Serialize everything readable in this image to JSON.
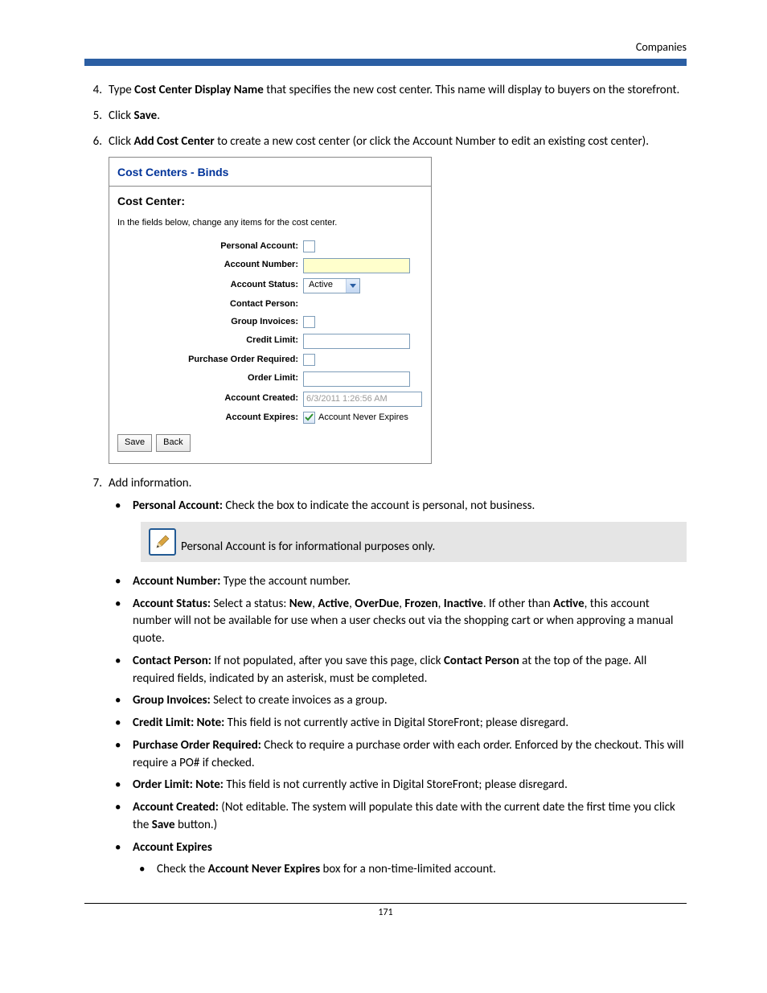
{
  "header": {
    "section": "Companies"
  },
  "steps": {
    "s4": {
      "pre": "Type ",
      "b": "Cost Center Display Name",
      "post": " that specifies the new cost center. This name will display to buyers on the storefront."
    },
    "s5": {
      "pre": "Click ",
      "b": "Save",
      "post": "."
    },
    "s6": {
      "pre": "Click ",
      "b": "Add Cost Center",
      "post": " to create a new cost center (or click the Account Number to edit an existing cost center)."
    },
    "s7": {
      "text": "Add information."
    }
  },
  "panel": {
    "title": "Cost Centers - Binds",
    "subtitle": "Cost Center:",
    "note": "In the fields below, change any items for the cost center.",
    "labels": {
      "personal": "Personal Account:",
      "acctnum": "Account Number:",
      "status": "Account Status:",
      "contact": "Contact Person:",
      "group": "Group Invoices:",
      "credit": "Credit Limit:",
      "po": "Purchase Order Required:",
      "order": "Order Limit:",
      "created": "Account Created:",
      "expires": "Account Expires:"
    },
    "values": {
      "status": "Active",
      "created": "6/3/2011 1:26:56 AM",
      "expires_label": "Account Never Expires"
    },
    "buttons": {
      "save": "Save",
      "back": "Back"
    }
  },
  "info7": {
    "personal": {
      "b": "Personal Account:",
      "t": " Check the box to indicate the account is personal, not business."
    },
    "note": "Personal Account is for informational purposes only.",
    "acctnum": {
      "b": "Account Number:",
      "t": " Type the account number."
    },
    "status": {
      "b": "Account Status:",
      "t1": " Select a status: ",
      "s1": "New",
      "c1": ", ",
      "s2": "Active",
      "c2": ", ",
      "s3": "OverDue",
      "c3": ", ",
      "s4": "Frozen",
      "c4": ", ",
      "s5": "Inactive",
      "t2": ". If other than ",
      "s6": "Active",
      "t3": ", this account number will not be available for use when a user checks out via the shopping cart or when approving a manual quote."
    },
    "contact": {
      "b": "Contact Person:",
      "t1": " If not populated, after you save this page, click ",
      "b2": "Contact Person",
      "t2": " at the top of the page. All required fields, indicated by an asterisk, must be completed."
    },
    "group": {
      "b": "Group Invoices:",
      "t": " Select to create invoices as a group."
    },
    "credit": {
      "b": "Credit Limit: Note:",
      "t": " This field is not currently active in Digital StoreFront; please disregard."
    },
    "po": {
      "b": "Purchase Order Required:",
      "t": " Check to require a purchase order with each order. Enforced by the checkout. This will require a PO# if checked."
    },
    "order": {
      "b": "Order Limit: Note:",
      "t": " This field is not currently active in Digital StoreFront; please disregard."
    },
    "created": {
      "b": "Account Created:",
      "t1": " (Not editable. The system will populate this date with the current date the first time you click the ",
      "b2": "Save",
      "t2": " button.)"
    },
    "expires": {
      "b": "Account Expires"
    },
    "expires_sub": {
      "t1": "Check the ",
      "b": "Account Never Expires",
      "t2": " box for a non-time-limited account."
    }
  },
  "page_number": "171"
}
